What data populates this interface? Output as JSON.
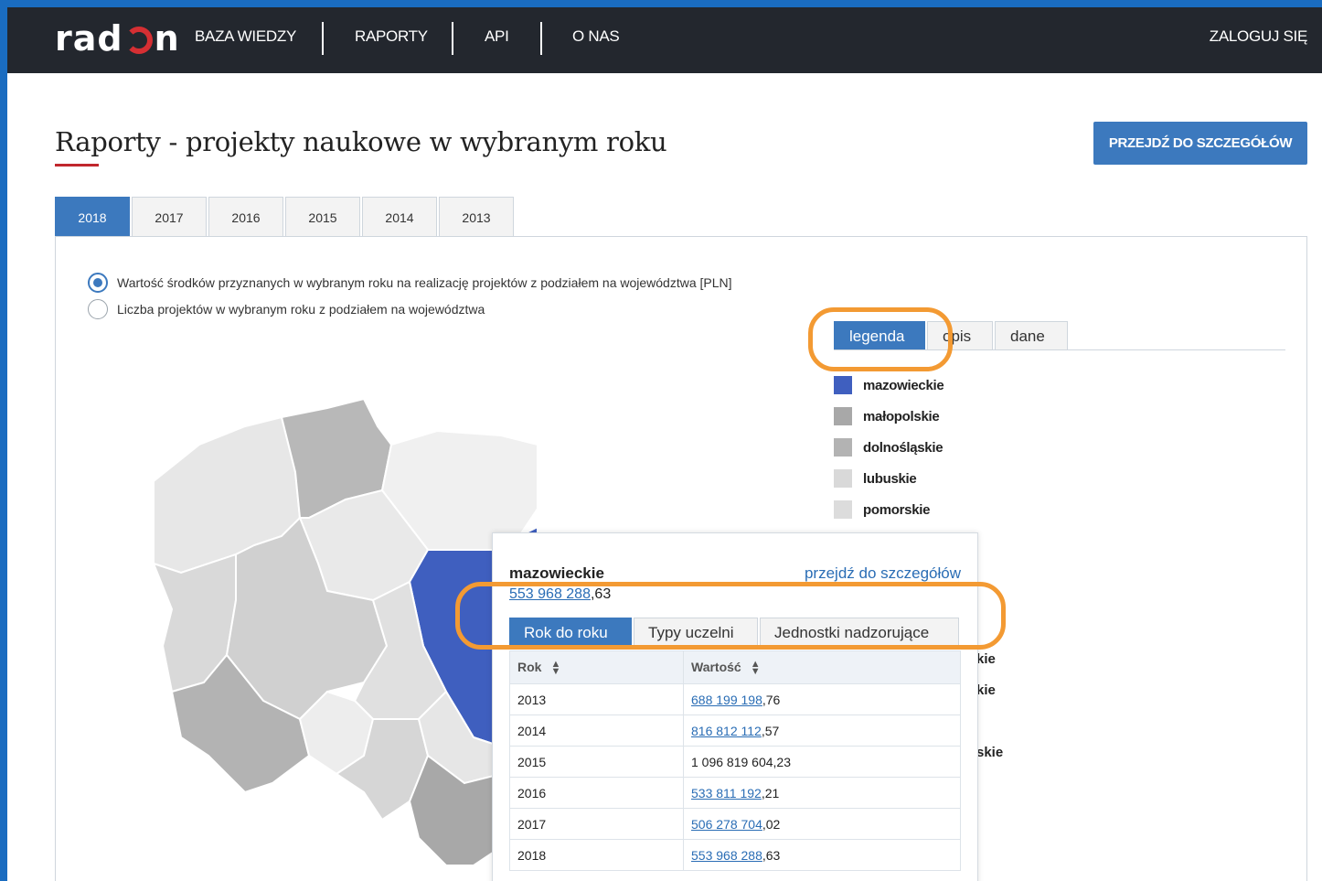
{
  "nav": {
    "logo_left": "rad",
    "logo_right": "n",
    "items": [
      "BAZA WIEDZY",
      "RAPORTY",
      "API",
      "O NAS"
    ],
    "login": "ZALOGUJ SIĘ"
  },
  "header": {
    "title": "Raporty - projekty naukowe w wybranym roku",
    "details_button": "PRZEJDŹ DO SZCZEGÓŁÓW"
  },
  "year_tabs": [
    "2018",
    "2017",
    "2016",
    "2015",
    "2014",
    "2013"
  ],
  "radios": [
    "Wartość środków przyznanych w wybranym roku na realizację projektów z podziałem na województwa [PLN]",
    "Liczba projektów w wybranym roku z podziałem na województwa"
  ],
  "legend_tabs": [
    "legenda",
    "opis",
    "dane"
  ],
  "legend": [
    {
      "label": "mazowieckie",
      "color": "#3f5fbf"
    },
    {
      "label": "małopolskie",
      "color": "#a8a8a8"
    },
    {
      "label": "dolnośląskie",
      "color": "#b3b3b3"
    },
    {
      "label": "lubuskie",
      "color": "#d9d9d9"
    },
    {
      "label": "pomorskie",
      "color": "#dcdcdc"
    }
  ],
  "legend_partial": [
    "kie",
    "kie",
    "skie"
  ],
  "card": {
    "region": "mazowieckie",
    "details_link": "przejdź do szczegółów",
    "value_link": "553 968 288",
    "value_rest": ",63",
    "tabs": [
      "Rok do roku",
      "Typy uczelni",
      "Jednostki nadzorujące"
    ],
    "table": {
      "headers": [
        "Rok",
        "Wartość"
      ],
      "rows": [
        {
          "year": "2013",
          "link": "688 199 198",
          "rest": ",76"
        },
        {
          "year": "2014",
          "link": "816 812 112",
          "rest": ",57"
        },
        {
          "year": "2015",
          "link": "",
          "rest": "1 096 819 604,23"
        },
        {
          "year": "2016",
          "link": "533 811 192",
          "rest": ",21"
        },
        {
          "year": "2017",
          "link": "506 278 704",
          "rest": ",02"
        },
        {
          "year": "2018",
          "link": "553 968 288",
          "rest": ",63"
        }
      ]
    }
  }
}
